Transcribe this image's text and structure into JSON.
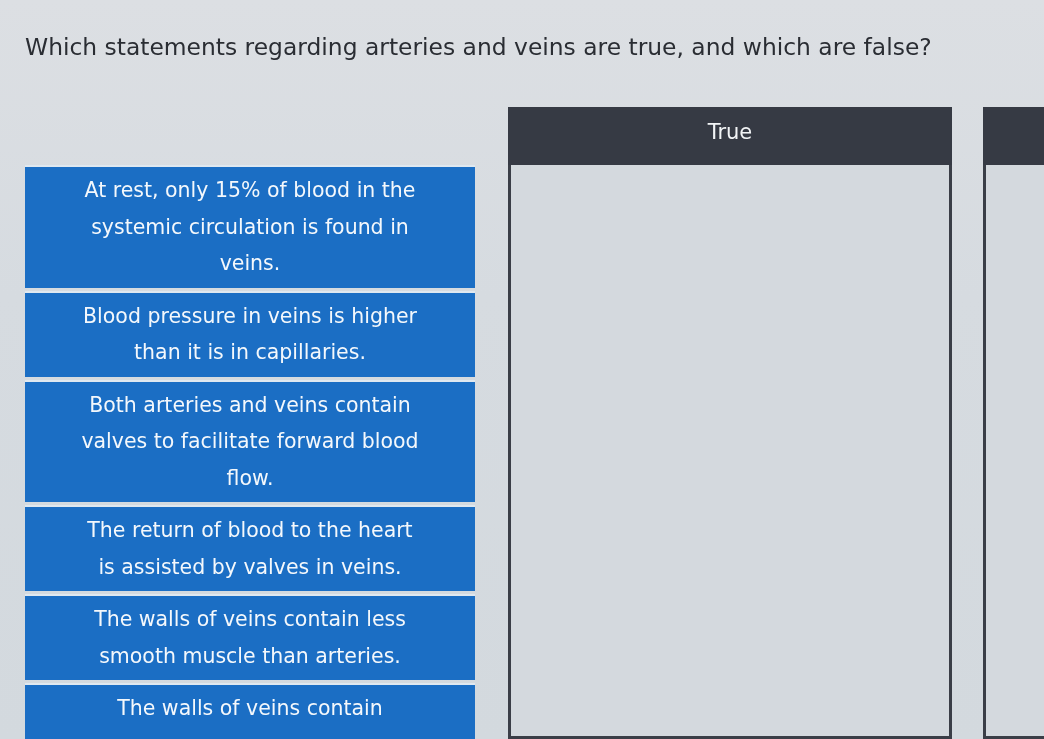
{
  "question": "Which statements regarding arteries and veins are true, and which are false?",
  "statements": [
    "At rest, only 15% of blood in the systemic circulation is found in veins.",
    "Blood pressure in veins is higher than it is in capillaries.",
    "Both arteries and veins contain valves to facilitate forward blood flow.",
    "The return of blood to the heart is assisted by valves in veins.",
    "The walls of veins contain less smooth muscle than arteries.",
    "The walls of veins contain"
  ],
  "columns": [
    {
      "heading": "True"
    },
    {}
  ]
}
